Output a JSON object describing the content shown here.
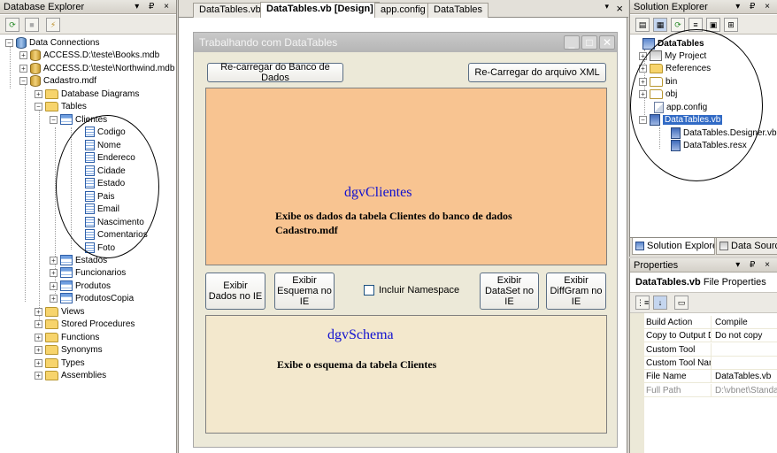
{
  "database_explorer": {
    "title": "Database Explorer",
    "title_buttons": "▾ ₽ ×",
    "tree": {
      "root": "Data Connections",
      "connections": [
        "ACCESS.D:\\teste\\Books.mdb",
        "ACCESS.D:\\teste\\Northwind.mdb",
        "Cadastro.mdf"
      ],
      "cadastro_children": [
        "Database Diagrams",
        "Tables"
      ],
      "tables": [
        "Clientes",
        "Estados",
        "Funcionarios",
        "Produtos",
        "ProdutosCopia"
      ],
      "clientes_columns": [
        "Codigo",
        "Nome",
        "Endereco",
        "Cidade",
        "Estado",
        "Pais",
        "Email",
        "Nascimento",
        "Comentarios",
        "Foto"
      ],
      "other_folders": [
        "Views",
        "Stored Procedures",
        "Functions",
        "Synonyms",
        "Types",
        "Assemblies"
      ]
    }
  },
  "document_tabs": {
    "tabs": [
      "DataTables.vb",
      "DataTables.vb [Design]",
      "app.config",
      "DataTables"
    ],
    "active_index": 1,
    "close_glyph": "×",
    "dropdown_glyph": "▾"
  },
  "form": {
    "title": "Trabalhando com DataTables",
    "reload_db_button": "Re-carregar do Banco de Dados",
    "reload_xml_button": "Re-Carregar do arquivo XML",
    "grid_clientes": {
      "name": "dgvClientes",
      "description": "Exibe os dados da tabela Clientes do banco de dados Cadastro.mdf",
      "color": "#f8c491"
    },
    "buttons_row": {
      "show_data": "Exibir Dados no IE",
      "show_schema": "Exibir Esquema no IE",
      "include_namespace": "Incluir Namespace",
      "show_dataset": "Exibir DataSet no IE",
      "show_diffgram": "Exibir DiffGram no IE"
    },
    "grid_schema": {
      "name": "dgvSchema",
      "description": "Exibe o esquema da tabela Clientes",
      "color": "#f3e8cd"
    }
  },
  "solution_explorer": {
    "title": "Solution Explorer",
    "title_buttons": "▾ ₽ ×",
    "tree": {
      "project": "DataTables",
      "items": [
        "My Project",
        "References",
        "bin",
        "obj",
        "app.config",
        "DataTables.vb"
      ],
      "children": [
        "DataTables.Designer.vb",
        "DataTables.resx"
      ]
    },
    "bottom_tabs": [
      "Solution Explorer",
      "Data Sources"
    ]
  },
  "properties": {
    "title": "Properties",
    "title_buttons": "▾ ₽ ×",
    "object_name": "DataTables.vb",
    "object_type": "File Properties",
    "rows": [
      {
        "name": "Build Action",
        "value": "Compile"
      },
      {
        "name": "Copy to Output Directory",
        "value": "Do not copy"
      },
      {
        "name": "Custom Tool",
        "value": ""
      },
      {
        "name": "Custom Tool Namespace",
        "value": ""
      },
      {
        "name": "File Name",
        "value": "DataTables.vb"
      },
      {
        "name": "Full Path",
        "value": "D:\\vbnet\\Standard"
      }
    ]
  }
}
